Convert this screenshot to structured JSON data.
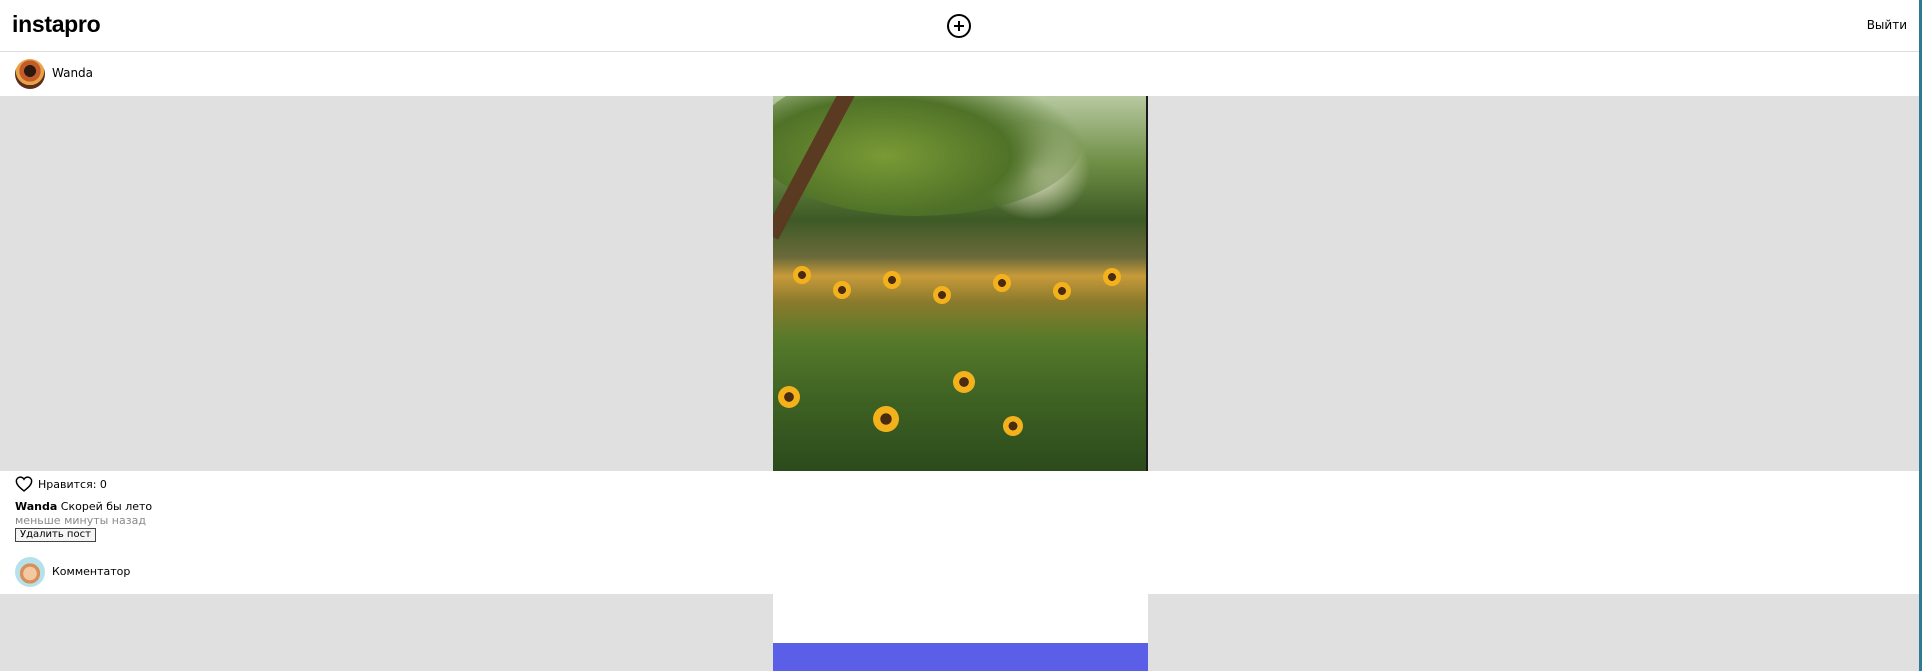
{
  "header": {
    "logo": "instapro",
    "add_icon": "plus-circle-icon",
    "logout_label": "Выйти"
  },
  "post": {
    "author": "Wanda",
    "likes_label": "Нравится: 0",
    "like_icon": "heart-outline-icon",
    "caption_user": "Wanda",
    "caption_text": "Скорей бы лето",
    "date": "меньше минуты назад",
    "delete_label": "Удалить пост",
    "commenter": "Комментатор"
  },
  "colors": {
    "band": "#e0e0e0",
    "next_post_accent": "#5b5fe8",
    "date_gray": "#8a8a8a"
  }
}
